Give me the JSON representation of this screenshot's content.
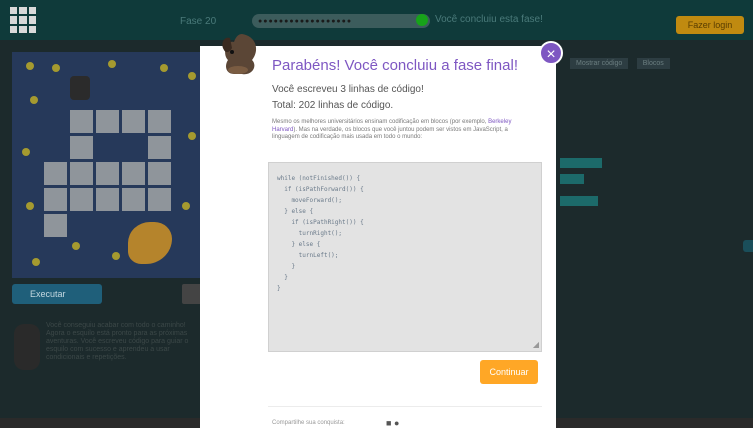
{
  "top_bar": {
    "left_text": "Fase 20",
    "progress_dots": "●●●●●●●●●●●●●●●●●●",
    "progress_fraction": 1.0,
    "message": "Você concluiu esta fase!",
    "signin_label": "Fazer login"
  },
  "play_area": {
    "run_button_label": "Executar",
    "instructions": "Você conseguiu acabar com todo o caminho! Agora o esquilo está pronto para as próximas aventuras. Você escreveu código para guiar o esquilo com sucesso e aprendeu a usar condicionais e repetições."
  },
  "toolbar_right": [
    "Mostrar código",
    "Blocos"
  ],
  "modal": {
    "title": "Parabéns! Você concluiu a fase final!",
    "lines_written": "Você escreveu 3 linhas de código!",
    "total_lines": "Total: 202 linhas de código.",
    "desc_part1": "Mesmo os melhores universitários ensinam codificação em blocos (por exemplo, ",
    "desc_link": "Berkeley Harvard",
    "desc_part2": "). Mas na verdade, os blocos que você juntou podem ser vistos em JavaScript, a linguagem de codificação mais usada em todo o mundo:",
    "code": "while (notFinished()) {\n  if (isPathForward()) {\n    moveForward();\n  } else {\n    if (isPathRight()) {\n      turnRight();\n    } else {\n      turnLeft();\n    }\n  }\n}",
    "continue_label": "Continuar",
    "footer_text": "Compartilhe sua conquista:",
    "close_symbol": "×"
  },
  "colors": {
    "accent_purple": "#7e57c2",
    "continue_orange": "#ffa726",
    "topbar_teal": "#0f3a3a",
    "code_bg": "#e3e3e3"
  }
}
